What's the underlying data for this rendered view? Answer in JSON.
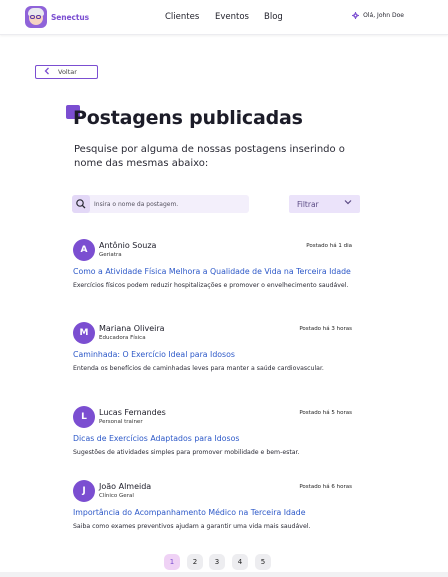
{
  "header": {
    "brand": "Senectus",
    "nav": [
      "Clientes",
      "Eventos",
      "Blog"
    ],
    "user_greeting": "Olá, John Doe"
  },
  "back_label": "Voltar",
  "page_title": "Postagens publicadas",
  "subtitle": "Pesquise por alguma de nossas postagens inserindo o nome das mesmas abaixo:",
  "search": {
    "placeholder": "Insira o nome da postagem."
  },
  "filter_label": "Filtrar",
  "posts": [
    {
      "initial": "A",
      "author": "Antônio Souza",
      "role": "Geriatra",
      "time": "Postado há 1 dia",
      "title": "Como a Atividade Física Melhora a Qualidade de Vida na Terceira Idade",
      "excerpt": "Exercícios físicos podem reduzir hospitalizações e promover o envelhecimento saudável."
    },
    {
      "initial": "M",
      "author": "Mariana Oliveira",
      "role": "Educadora Física",
      "time": "Postado há 3 horas",
      "title": "Caminhada: O Exercício Ideal para Idosos",
      "excerpt": "Entenda os benefícios de caminhadas leves para manter a saúde cardiovascular."
    },
    {
      "initial": "L",
      "author": "Lucas Fernandes",
      "role": "Personal trainer",
      "time": "Postado há 5 horas",
      "title": "Dicas de Exercícios Adaptados para Idosos",
      "excerpt": "Sugestões de atividades simples para promover mobilidade e bem-estar."
    },
    {
      "initial": "J",
      "author": "João Almeida",
      "role": "Clínico Geral",
      "time": "Postado há 6 horas",
      "title": "Importância do Acompanhamento Médico na Terceira Idade",
      "excerpt": "Saiba como exames preventivos ajudam a garantir uma vida mais saudável."
    }
  ],
  "pagination": {
    "pages": [
      "1",
      "2",
      "3",
      "4",
      "5"
    ],
    "current": "1"
  },
  "colors": {
    "accent": "#7b4ed1",
    "link": "#2c58c8",
    "active_page": "#efd2f5"
  },
  "icons": [
    "logo-icon",
    "gear-icon",
    "chevron-left-icon",
    "search-icon",
    "chevron-down-icon"
  ]
}
